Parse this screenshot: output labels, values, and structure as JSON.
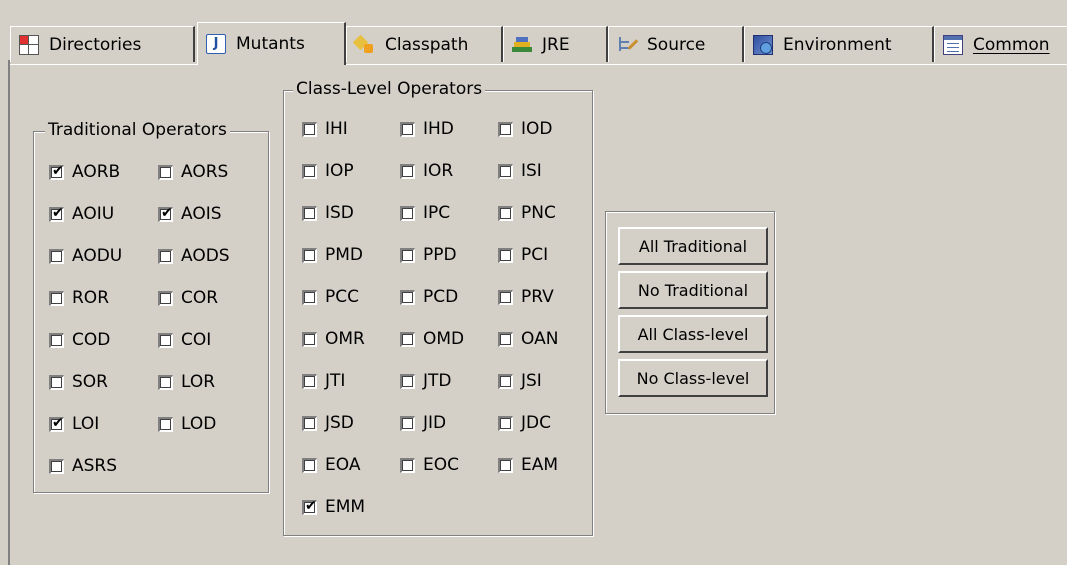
{
  "tabs": [
    {
      "label": "Directories",
      "icon": "directories-icon",
      "active": false
    },
    {
      "label": "Mutants",
      "icon": "java-file-icon",
      "active": true
    },
    {
      "label": "Classpath",
      "icon": "classpath-icon",
      "active": false
    },
    {
      "label": "JRE",
      "icon": "jre-library-icon",
      "active": false
    },
    {
      "label": "Source",
      "icon": "source-lookup-icon",
      "active": false
    },
    {
      "label": "Environment",
      "icon": "environment-icon",
      "active": false
    },
    {
      "label": "Common",
      "icon": "common-icon",
      "active": false
    }
  ],
  "traditional": {
    "title": "Traditional Operators",
    "operators": [
      {
        "label": "AORB",
        "checked": true
      },
      {
        "label": "AORS",
        "checked": false
      },
      {
        "label": "AOIU",
        "checked": true
      },
      {
        "label": "AOIS",
        "checked": true
      },
      {
        "label": "AODU",
        "checked": false
      },
      {
        "label": "AODS",
        "checked": false
      },
      {
        "label": "ROR",
        "checked": false
      },
      {
        "label": "COR",
        "checked": false
      },
      {
        "label": "COD",
        "checked": false
      },
      {
        "label": "COI",
        "checked": false
      },
      {
        "label": "SOR",
        "checked": false
      },
      {
        "label": "LOR",
        "checked": false
      },
      {
        "label": "LOI",
        "checked": true
      },
      {
        "label": "LOD",
        "checked": false
      },
      {
        "label": "ASRS",
        "checked": false
      }
    ]
  },
  "class_level": {
    "title": "Class-Level Operators",
    "operators": [
      {
        "label": "IHI",
        "checked": false
      },
      {
        "label": "IHD",
        "checked": false
      },
      {
        "label": "IOD",
        "checked": false
      },
      {
        "label": "IOP",
        "checked": false
      },
      {
        "label": "IOR",
        "checked": false
      },
      {
        "label": "ISI",
        "checked": false
      },
      {
        "label": "ISD",
        "checked": false
      },
      {
        "label": "IPC",
        "checked": false
      },
      {
        "label": "PNC",
        "checked": false
      },
      {
        "label": "PMD",
        "checked": false
      },
      {
        "label": "PPD",
        "checked": false
      },
      {
        "label": "PCI",
        "checked": false
      },
      {
        "label": "PCC",
        "checked": false
      },
      {
        "label": "PCD",
        "checked": false
      },
      {
        "label": "PRV",
        "checked": false
      },
      {
        "label": "OMR",
        "checked": false
      },
      {
        "label": "OMD",
        "checked": false
      },
      {
        "label": "OAN",
        "checked": false
      },
      {
        "label": "JTI",
        "checked": false
      },
      {
        "label": "JTD",
        "checked": false
      },
      {
        "label": "JSI",
        "checked": false
      },
      {
        "label": "JSD",
        "checked": false
      },
      {
        "label": "JID",
        "checked": false
      },
      {
        "label": "JDC",
        "checked": false
      },
      {
        "label": "EOA",
        "checked": false
      },
      {
        "label": "EOC",
        "checked": false
      },
      {
        "label": "EAM",
        "checked": false
      },
      {
        "label": "EMM",
        "checked": true
      }
    ]
  },
  "buttons": {
    "all_traditional": "All Traditional",
    "no_traditional": "No Traditional",
    "all_class_level": "All Class-level",
    "no_class_level": "No Class-level"
  }
}
